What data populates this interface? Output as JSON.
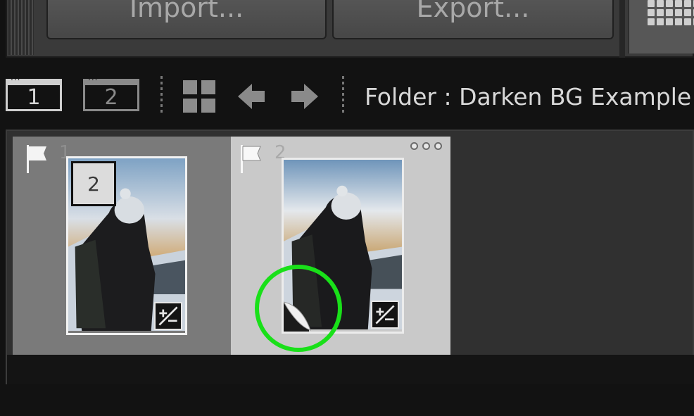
{
  "top_panel": {
    "import_label": "Import...",
    "export_label": "Export..."
  },
  "toolbar": {
    "primary_screen_label": "1",
    "secondary_screen_label": "2",
    "folder_text": "Folder : Darken BG Example"
  },
  "filmstrip": {
    "items": [
      {
        "index": "1",
        "stack_count": "2",
        "selected": false
      },
      {
        "index": "2",
        "selected": true
      }
    ]
  },
  "annotation": {
    "ring_color": "#19e019"
  },
  "colors": {
    "panel_bg": "#3a3a3a",
    "toolbar_bg": "#121212",
    "cell_unselected": "#7a7a7a",
    "cell_selected": "#c9c9c9"
  },
  "icons": {
    "toolbar": [
      "grid-view-icon",
      "previous-arrow-icon",
      "next-arrow-icon"
    ],
    "cell": [
      "flag-icon",
      "more-options-icon",
      "develop-adjusted-icon",
      "page-curl-icon"
    ]
  }
}
